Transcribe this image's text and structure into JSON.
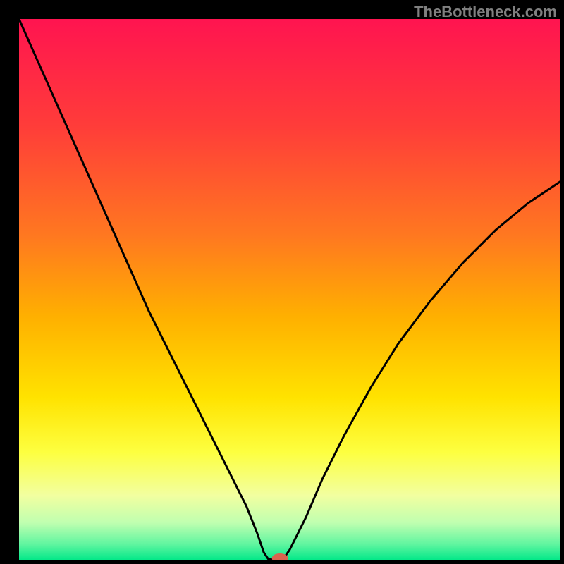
{
  "attribution": "TheBottleneck.com",
  "chart_data": {
    "type": "line",
    "title": "",
    "xlabel": "",
    "ylabel": "",
    "xlim": [
      0,
      100
    ],
    "ylim": [
      0,
      100
    ],
    "notch_x": 47,
    "background": {
      "type": "vertical-gradient",
      "stops": [
        {
          "offset": 0.0,
          "color": "#ff1450"
        },
        {
          "offset": 0.2,
          "color": "#ff3d39"
        },
        {
          "offset": 0.4,
          "color": "#ff7820"
        },
        {
          "offset": 0.55,
          "color": "#ffb000"
        },
        {
          "offset": 0.7,
          "color": "#ffe300"
        },
        {
          "offset": 0.8,
          "color": "#fdff40"
        },
        {
          "offset": 0.88,
          "color": "#f2ffa0"
        },
        {
          "offset": 0.93,
          "color": "#c0ffb0"
        },
        {
          "offset": 0.97,
          "color": "#60f5a0"
        },
        {
          "offset": 1.0,
          "color": "#00e888"
        }
      ]
    },
    "marker": {
      "x": 48.2,
      "y": 0.4,
      "rx": 1.5,
      "ry": 0.9,
      "color": "#d9644e"
    },
    "series": [
      {
        "name": "bottleneck-curve",
        "x": [
          0,
          4,
          8,
          12,
          16,
          20,
          24,
          28,
          32,
          36,
          39,
          42,
          44,
          45.2,
          46.0,
          48.8,
          50,
          53,
          56,
          60,
          65,
          70,
          76,
          82,
          88,
          94,
          100
        ],
        "y": [
          100,
          91,
          82,
          73,
          64,
          55,
          46,
          38,
          30,
          22,
          16,
          10,
          5,
          1.5,
          0.3,
          0.3,
          2,
          8,
          15,
          23,
          32,
          40,
          48,
          55,
          61,
          66,
          70
        ]
      }
    ]
  }
}
